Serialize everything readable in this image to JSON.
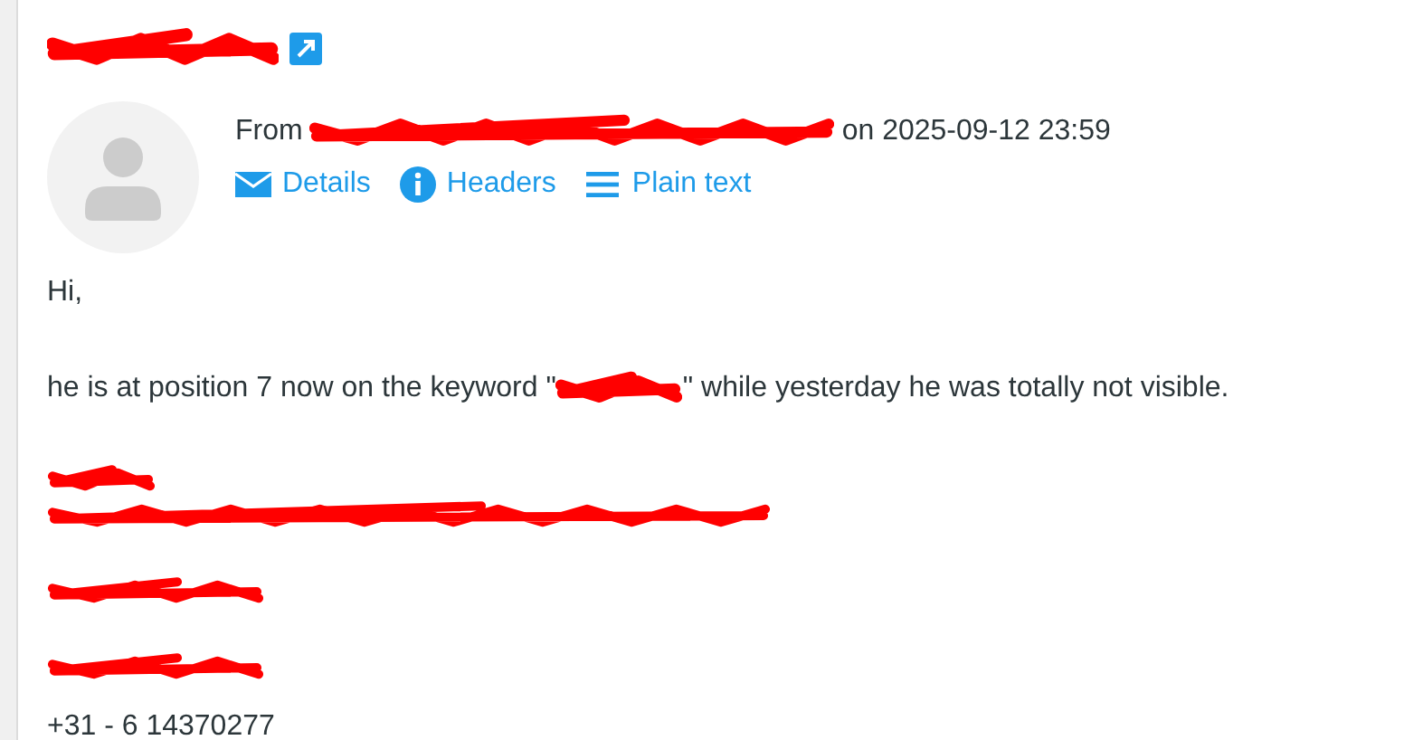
{
  "message": {
    "subject_redacted": true,
    "open_in_new_window": true
  },
  "header": {
    "from_label": "From",
    "sender_redacted": true,
    "date_text": "on 2025-09-12 23:59"
  },
  "actions": [
    {
      "kind": "envelope",
      "label": "Details"
    },
    {
      "kind": "info",
      "label": "Headers"
    },
    {
      "kind": "lines",
      "label": "Plain text"
    }
  ],
  "body": [
    {
      "kind": "text",
      "text": "Hi,"
    },
    {
      "kind": "sentence",
      "before": "he is at position 7 now on the keyword \"",
      "after": "\" while yesterday he was totally not visible."
    },
    {
      "kind": "redacted"
    },
    {
      "kind": "redacted"
    },
    {
      "kind": "redacted"
    },
    {
      "kind": "redacted"
    },
    {
      "kind": "text",
      "text": "+31 - 6 14370277"
    }
  ]
}
